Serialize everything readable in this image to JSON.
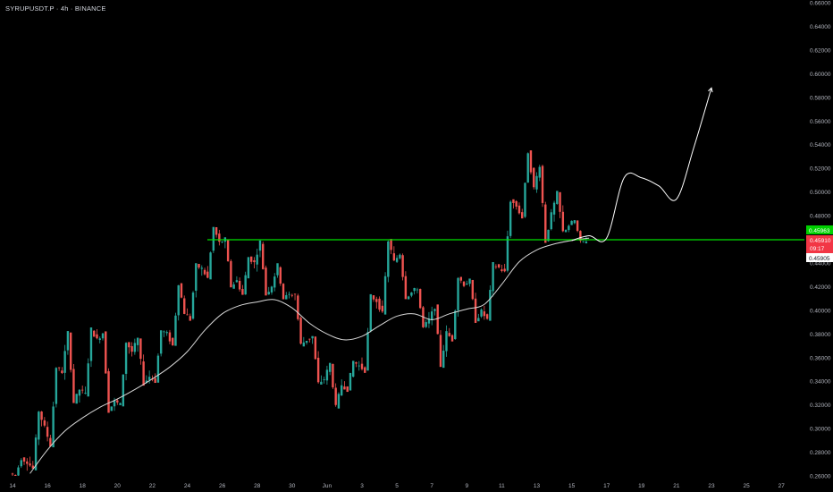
{
  "header": {
    "symbol": "SYRUPUSDT.P · 4h · BINANCE"
  },
  "colors": {
    "background": "#000000",
    "up": "#26a69a",
    "down": "#ef5350",
    "level_line": "#00e000",
    "moving_average": "#d8d8d8",
    "projection": "#ffffff",
    "axis_text": "#b2b5be"
  },
  "price_axis": {
    "labels": [
      "0.66000",
      "0.64000",
      "0.62000",
      "0.60000",
      "0.58000",
      "0.56000",
      "0.54000",
      "0.52000",
      "0.50000",
      "0.48000",
      "0.46000",
      "0.44000",
      "0.42000",
      "0.40000",
      "0.38000",
      "0.36000",
      "0.34000",
      "0.32000",
      "0.30000",
      "0.28000",
      "0.26000"
    ]
  },
  "badges": {
    "green": "0.45963",
    "red_price": "0.45910",
    "red_timer": "09:17",
    "white": "0.45905"
  },
  "chart_data": {
    "type": "candlestick",
    "title": "SYRUPUSDT.P · 4h · BINANCE",
    "timeframe": "4h",
    "ylim": [
      0.26,
      0.66
    ],
    "x_ticks": [
      "14",
      "16",
      "18",
      "20",
      "22",
      "24",
      "26",
      "28",
      "30",
      "Jun",
      "3",
      "5",
      "7",
      "9",
      "11",
      "13",
      "15",
      "17",
      "19",
      "21",
      "23",
      "25",
      "27"
    ],
    "horizontal_level": 0.4596,
    "moving_average_points": [
      {
        "date": "May 15",
        "value": 0.262
      },
      {
        "date": "May 16",
        "value": 0.282
      },
      {
        "date": "May 17",
        "value": 0.298
      },
      {
        "date": "May 18",
        "value": 0.309
      },
      {
        "date": "May 19",
        "value": 0.318
      },
      {
        "date": "May 20",
        "value": 0.325
      },
      {
        "date": "May 21",
        "value": 0.333
      },
      {
        "date": "May 22",
        "value": 0.342
      },
      {
        "date": "May 23",
        "value": 0.352
      },
      {
        "date": "May 24",
        "value": 0.365
      },
      {
        "date": "May 25",
        "value": 0.383
      },
      {
        "date": "May 26",
        "value": 0.397
      },
      {
        "date": "May 27",
        "value": 0.404
      },
      {
        "date": "May 28",
        "value": 0.407
      },
      {
        "date": "May 29",
        "value": 0.409
      },
      {
        "date": "May 30",
        "value": 0.402
      },
      {
        "date": "May 31",
        "value": 0.389
      },
      {
        "date": "Jun 1",
        "value": 0.38
      },
      {
        "date": "Jun 2",
        "value": 0.375
      },
      {
        "date": "Jun 3",
        "value": 0.378
      },
      {
        "date": "Jun 4",
        "value": 0.387
      },
      {
        "date": "Jun 5",
        "value": 0.395
      },
      {
        "date": "Jun 6",
        "value": 0.397
      },
      {
        "date": "Jun 7",
        "value": 0.392
      },
      {
        "date": "Jun 8",
        "value": 0.397
      },
      {
        "date": "Jun 9",
        "value": 0.401
      },
      {
        "date": "Jun 10",
        "value": 0.405
      },
      {
        "date": "Jun 11",
        "value": 0.422
      },
      {
        "date": "Jun 12",
        "value": 0.441
      },
      {
        "date": "Jun 13",
        "value": 0.451
      },
      {
        "date": "Jun 14",
        "value": 0.456
      },
      {
        "date": "Jun 15",
        "value": 0.459
      },
      {
        "date": "Jun 16",
        "value": 0.461
      }
    ],
    "projection_points": [
      {
        "date": "Jun 15",
        "value": 0.459
      },
      {
        "date": "Jun 16",
        "value": 0.463
      },
      {
        "date": "Jun 17",
        "value": 0.461
      },
      {
        "date": "Jun 18",
        "value": 0.512
      },
      {
        "date": "Jun 19",
        "value": 0.512
      },
      {
        "date": "Jun 20",
        "value": 0.505
      },
      {
        "date": "Jun 21",
        "value": 0.494
      },
      {
        "date": "Jun 22",
        "value": 0.538
      },
      {
        "date": "Jun 23",
        "value": 0.588
      }
    ],
    "daily_ohlc": [
      {
        "date": "May 14",
        "open": 0.262,
        "high": 0.275,
        "low": 0.26,
        "close": 0.272
      },
      {
        "date": "May 15",
        "open": 0.272,
        "high": 0.315,
        "low": 0.266,
        "close": 0.301
      },
      {
        "date": "May 16",
        "open": 0.301,
        "high": 0.352,
        "low": 0.286,
        "close": 0.348
      },
      {
        "date": "May 17",
        "open": 0.348,
        "high": 0.381,
        "low": 0.322,
        "close": 0.333
      },
      {
        "date": "May 18",
        "open": 0.333,
        "high": 0.384,
        "low": 0.329,
        "close": 0.375
      },
      {
        "date": "May 19",
        "open": 0.375,
        "high": 0.381,
        "low": 0.315,
        "close": 0.323
      },
      {
        "date": "May 20",
        "open": 0.323,
        "high": 0.373,
        "low": 0.32,
        "close": 0.365
      },
      {
        "date": "May 21",
        "open": 0.365,
        "high": 0.376,
        "low": 0.338,
        "close": 0.344
      },
      {
        "date": "May 22",
        "open": 0.344,
        "high": 0.383,
        "low": 0.34,
        "close": 0.38
      },
      {
        "date": "May 23",
        "open": 0.38,
        "high": 0.423,
        "low": 0.37,
        "close": 0.398
      },
      {
        "date": "May 24",
        "open": 0.398,
        "high": 0.438,
        "low": 0.392,
        "close": 0.435
      },
      {
        "date": "May 25",
        "open": 0.435,
        "high": 0.47,
        "low": 0.427,
        "close": 0.457
      },
      {
        "date": "May 26",
        "open": 0.457,
        "high": 0.46,
        "low": 0.42,
        "close": 0.425
      },
      {
        "date": "May 27",
        "open": 0.425,
        "high": 0.445,
        "low": 0.413,
        "close": 0.44
      },
      {
        "date": "May 28",
        "open": 0.44,
        "high": 0.458,
        "low": 0.413,
        "close": 0.421
      },
      {
        "date": "May 29",
        "open": 0.421,
        "high": 0.438,
        "low": 0.41,
        "close": 0.413
      },
      {
        "date": "May 30",
        "open": 0.413,
        "high": 0.414,
        "low": 0.371,
        "close": 0.375
      },
      {
        "date": "May 31",
        "open": 0.375,
        "high": 0.378,
        "low": 0.338,
        "close": 0.342
      },
      {
        "date": "Jun 1",
        "open": 0.342,
        "high": 0.355,
        "low": 0.318,
        "close": 0.337
      },
      {
        "date": "Jun 2",
        "open": 0.337,
        "high": 0.357,
        "low": 0.333,
        "close": 0.353
      },
      {
        "date": "Jun 3",
        "open": 0.353,
        "high": 0.412,
        "low": 0.349,
        "close": 0.408
      },
      {
        "date": "Jun 4",
        "open": 0.408,
        "high": 0.459,
        "low": 0.397,
        "close": 0.441
      },
      {
        "date": "Jun 5",
        "open": 0.441,
        "high": 0.448,
        "low": 0.411,
        "close": 0.415
      },
      {
        "date": "Jun 6",
        "open": 0.415,
        "high": 0.419,
        "low": 0.385,
        "close": 0.392
      },
      {
        "date": "Jun 7",
        "open": 0.392,
        "high": 0.403,
        "low": 0.353,
        "close": 0.381
      },
      {
        "date": "Jun 8",
        "open": 0.381,
        "high": 0.428,
        "low": 0.375,
        "close": 0.422
      },
      {
        "date": "Jun 9",
        "open": 0.422,
        "high": 0.425,
        "low": 0.391,
        "close": 0.399
      },
      {
        "date": "Jun 10",
        "open": 0.399,
        "high": 0.439,
        "low": 0.392,
        "close": 0.436
      },
      {
        "date": "Jun 11",
        "open": 0.436,
        "high": 0.493,
        "low": 0.432,
        "close": 0.488
      },
      {
        "date": "Jun 12",
        "open": 0.488,
        "high": 0.534,
        "low": 0.478,
        "close": 0.503
      },
      {
        "date": "Jun 13",
        "open": 0.503,
        "high": 0.523,
        "low": 0.458,
        "close": 0.481
      },
      {
        "date": "Jun 14",
        "open": 0.481,
        "high": 0.499,
        "low": 0.466,
        "close": 0.472
      },
      {
        "date": "Jun 15",
        "open": 0.472,
        "high": 0.476,
        "low": 0.457,
        "close": 0.459
      }
    ]
  }
}
